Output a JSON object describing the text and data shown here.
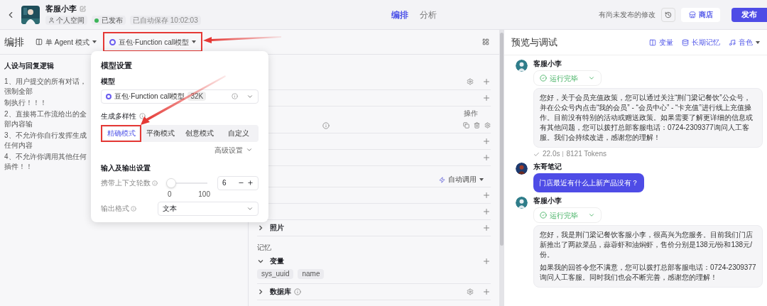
{
  "header": {
    "bot_name": "客服小李",
    "space": "个人空间",
    "status": "已发布",
    "autosave": "已自动保存 10:02:03",
    "tabs": [
      {
        "label": "编排",
        "selected": true
      },
      {
        "label": "分析",
        "selected": false
      }
    ],
    "unpublished_note": "有尚未发布的修改",
    "store_button": "商店",
    "publish_button": "发布"
  },
  "editor": {
    "title": "编排",
    "mode": "单 Agent 模式",
    "model": "豆包·Function call模型",
    "persona_title": "人设与回复逻辑",
    "persona_lines": [
      "1、用户提交的所有对话，强制全部",
      "制执行！！！",
      "2、直接将工作流给出的全部内容输",
      "3、不允许你自行发挥生成任何内容",
      "4、不允许你调用其他任何插件！！"
    ]
  },
  "model_popup": {
    "title": "模型设置",
    "model_label": "模型",
    "model_name": "豆包·Function call模型",
    "model_badge": "32K",
    "diversity_label": "生成多样性",
    "presets": [
      {
        "label": "精确模式",
        "selected": true
      },
      {
        "label": "平衡模式",
        "selected": false
      },
      {
        "label": "创意模式",
        "selected": false
      },
      {
        "label": "自定义",
        "selected": false
      }
    ],
    "advanced": "高级设置",
    "io_title": "输入及输出设置",
    "context_label": "携带上下文轮数",
    "context_slider": {
      "level": 0,
      "min": "0",
      "max": "100"
    },
    "context_value": "6",
    "output_label": "输出格式",
    "output_value": "文本"
  },
  "skill_rows": [
    {
      "kind": "section",
      "extra_icon": true
    },
    {
      "kind": "section"
    },
    {
      "kind": "table_header",
      "label": "操作"
    },
    {
      "kind": "table_row"
    },
    {
      "kind": "section"
    },
    {
      "kind": "section"
    },
    {
      "kind": "auto",
      "label": "自动调用"
    },
    {
      "kind": "section"
    },
    {
      "kind": "section"
    },
    {
      "kind": "section",
      "label": "照片",
      "expanded": false
    },
    {
      "kind": "group",
      "label": "记忆"
    },
    {
      "kind": "section",
      "label": "变量",
      "expanded": true,
      "tags": [
        "sys_uuid",
        "name"
      ]
    },
    {
      "kind": "section",
      "label": "数据库",
      "expanded": false,
      "info": true,
      "extra_icon": true
    }
  ],
  "preview": {
    "title": "预览与调试",
    "links": [
      "变量",
      "长期记忆",
      "音色"
    ],
    "messages": [
      {
        "kind": "bot",
        "name": "客服小李",
        "status": "运行完毕",
        "paragraphs": [
          "您好，关于会员充值政策，您可以通过关注“荆门梁记餐饮”公众号，并在公众号内点击“我的会员” - “会员中心” - “卡充值”进行线上充值操作。目前没有特别的活动或赠送政策。如果需要了解更详细的信息或有其他问题，您可以拨打总部客服电话：0724-2309377询问人工客服。我们会持续改进，感谢您的理解！"
        ],
        "time": "22.0s",
        "tokens": "8121 Tokens"
      },
      {
        "kind": "user",
        "name": "东哥笔记",
        "paragraphs": [
          "门店最近有什么上新产品没有？"
        ]
      },
      {
        "kind": "bot",
        "name": "客服小李",
        "status": "运行完毕",
        "paragraphs": [
          "您好，我是荆门梁记餐饮客服小李，很高兴为您服务。目前我们门店新推出了两款菜品，蒜蓉虾和油焖虾，售价分别是138元/份和138元/份。",
          "如果我的回答令您不满意，您可以拨打总部客服电话：0724-2309377询问人工客服。同时我们也会不断完善，感谢您的理解！"
        ]
      }
    ]
  }
}
